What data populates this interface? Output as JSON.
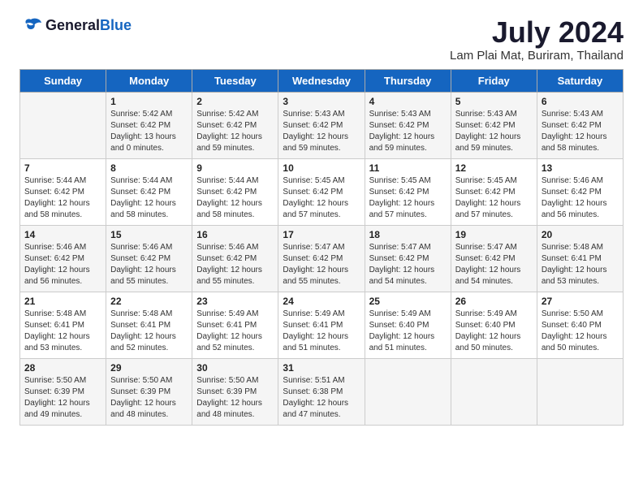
{
  "header": {
    "logo_general": "General",
    "logo_blue": "Blue",
    "title": "July 2024",
    "subtitle": "Lam Plai Mat, Buriram, Thailand"
  },
  "days_of_week": [
    "Sunday",
    "Monday",
    "Tuesday",
    "Wednesday",
    "Thursday",
    "Friday",
    "Saturday"
  ],
  "weeks": [
    [
      {
        "day": "",
        "sunrise": "",
        "sunset": "",
        "daylight": ""
      },
      {
        "day": "1",
        "sunrise": "5:42 AM",
        "sunset": "6:42 PM",
        "daylight": "13 hours and 0 minutes."
      },
      {
        "day": "2",
        "sunrise": "5:42 AM",
        "sunset": "6:42 PM",
        "daylight": "12 hours and 59 minutes."
      },
      {
        "day": "3",
        "sunrise": "5:43 AM",
        "sunset": "6:42 PM",
        "daylight": "12 hours and 59 minutes."
      },
      {
        "day": "4",
        "sunrise": "5:43 AM",
        "sunset": "6:42 PM",
        "daylight": "12 hours and 59 minutes."
      },
      {
        "day": "5",
        "sunrise": "5:43 AM",
        "sunset": "6:42 PM",
        "daylight": "12 hours and 59 minutes."
      },
      {
        "day": "6",
        "sunrise": "5:43 AM",
        "sunset": "6:42 PM",
        "daylight": "12 hours and 58 minutes."
      }
    ],
    [
      {
        "day": "7",
        "sunrise": "5:44 AM",
        "sunset": "6:42 PM",
        "daylight": "12 hours and 58 minutes."
      },
      {
        "day": "8",
        "sunrise": "5:44 AM",
        "sunset": "6:42 PM",
        "daylight": "12 hours and 58 minutes."
      },
      {
        "day": "9",
        "sunrise": "5:44 AM",
        "sunset": "6:42 PM",
        "daylight": "12 hours and 58 minutes."
      },
      {
        "day": "10",
        "sunrise": "5:45 AM",
        "sunset": "6:42 PM",
        "daylight": "12 hours and 57 minutes."
      },
      {
        "day": "11",
        "sunrise": "5:45 AM",
        "sunset": "6:42 PM",
        "daylight": "12 hours and 57 minutes."
      },
      {
        "day": "12",
        "sunrise": "5:45 AM",
        "sunset": "6:42 PM",
        "daylight": "12 hours and 57 minutes."
      },
      {
        "day": "13",
        "sunrise": "5:46 AM",
        "sunset": "6:42 PM",
        "daylight": "12 hours and 56 minutes."
      }
    ],
    [
      {
        "day": "14",
        "sunrise": "5:46 AM",
        "sunset": "6:42 PM",
        "daylight": "12 hours and 56 minutes."
      },
      {
        "day": "15",
        "sunrise": "5:46 AM",
        "sunset": "6:42 PM",
        "daylight": "12 hours and 55 minutes."
      },
      {
        "day": "16",
        "sunrise": "5:46 AM",
        "sunset": "6:42 PM",
        "daylight": "12 hours and 55 minutes."
      },
      {
        "day": "17",
        "sunrise": "5:47 AM",
        "sunset": "6:42 PM",
        "daylight": "12 hours and 55 minutes."
      },
      {
        "day": "18",
        "sunrise": "5:47 AM",
        "sunset": "6:42 PM",
        "daylight": "12 hours and 54 minutes."
      },
      {
        "day": "19",
        "sunrise": "5:47 AM",
        "sunset": "6:42 PM",
        "daylight": "12 hours and 54 minutes."
      },
      {
        "day": "20",
        "sunrise": "5:48 AM",
        "sunset": "6:41 PM",
        "daylight": "12 hours and 53 minutes."
      }
    ],
    [
      {
        "day": "21",
        "sunrise": "5:48 AM",
        "sunset": "6:41 PM",
        "daylight": "12 hours and 53 minutes."
      },
      {
        "day": "22",
        "sunrise": "5:48 AM",
        "sunset": "6:41 PM",
        "daylight": "12 hours and 52 minutes."
      },
      {
        "day": "23",
        "sunrise": "5:49 AM",
        "sunset": "6:41 PM",
        "daylight": "12 hours and 52 minutes."
      },
      {
        "day": "24",
        "sunrise": "5:49 AM",
        "sunset": "6:41 PM",
        "daylight": "12 hours and 51 minutes."
      },
      {
        "day": "25",
        "sunrise": "5:49 AM",
        "sunset": "6:40 PM",
        "daylight": "12 hours and 51 minutes."
      },
      {
        "day": "26",
        "sunrise": "5:49 AM",
        "sunset": "6:40 PM",
        "daylight": "12 hours and 50 minutes."
      },
      {
        "day": "27",
        "sunrise": "5:50 AM",
        "sunset": "6:40 PM",
        "daylight": "12 hours and 50 minutes."
      }
    ],
    [
      {
        "day": "28",
        "sunrise": "5:50 AM",
        "sunset": "6:39 PM",
        "daylight": "12 hours and 49 minutes."
      },
      {
        "day": "29",
        "sunrise": "5:50 AM",
        "sunset": "6:39 PM",
        "daylight": "12 hours and 48 minutes."
      },
      {
        "day": "30",
        "sunrise": "5:50 AM",
        "sunset": "6:39 PM",
        "daylight": "12 hours and 48 minutes."
      },
      {
        "day": "31",
        "sunrise": "5:51 AM",
        "sunset": "6:38 PM",
        "daylight": "12 hours and 47 minutes."
      },
      {
        "day": "",
        "sunrise": "",
        "sunset": "",
        "daylight": ""
      },
      {
        "day": "",
        "sunrise": "",
        "sunset": "",
        "daylight": ""
      },
      {
        "day": "",
        "sunrise": "",
        "sunset": "",
        "daylight": ""
      }
    ]
  ]
}
